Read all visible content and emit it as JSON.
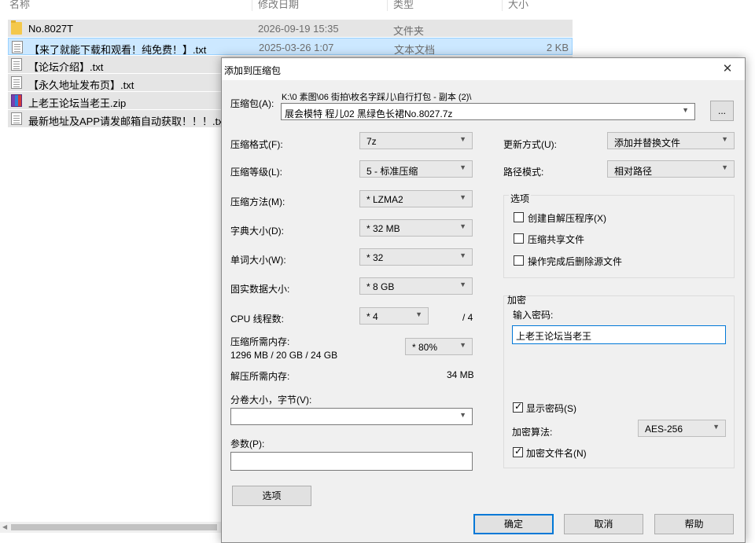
{
  "explorer": {
    "columns": {
      "name": "名称",
      "date": "修改日期",
      "type": "类型",
      "size": "大小"
    },
    "files": [
      {
        "name": "No.8027T",
        "date": "2026-09-19 15:35",
        "type": "文件夹",
        "size": "",
        "icon": "folder-icon"
      },
      {
        "name": "【来了就能下载和观看！纯免费！】.txt",
        "date": "2025-03-26 1:07",
        "type": "文本文档",
        "size": "2 KB",
        "icon": "text-file-icon"
      },
      {
        "name": "【论坛介绍】.txt",
        "date": "",
        "type": "",
        "size": "",
        "icon": "text-file-icon"
      },
      {
        "name": "【永久地址发布页】.txt",
        "date": "",
        "type": "",
        "size": "",
        "icon": "text-file-icon"
      },
      {
        "name": "上老王论坛当老王.zip",
        "date": "",
        "type": "",
        "size": "",
        "icon": "zip-file-icon"
      },
      {
        "name": "最新地址及APP请发邮箱自动获取！！！.txt",
        "date": "",
        "type": "",
        "size": "",
        "icon": "text-file-icon"
      }
    ]
  },
  "dialog": {
    "title": "添加到压缩包",
    "close": "✕",
    "archive": {
      "label": "压缩包(A):",
      "path": "K:\\0 素图\\06 街拍\\枚名字踩儿\\自行打包 - 副本 (2)\\",
      "filename": "展会模特 程儿02 黑绿色长裙No.8027.7z",
      "browse": "..."
    },
    "left": {
      "format": {
        "label": "压缩格式(F):",
        "value": "7z"
      },
      "level": {
        "label": "压缩等级(L):",
        "value": "5 - 标准压缩"
      },
      "method": {
        "label": "压缩方法(M):",
        "value": "* LZMA2"
      },
      "dict": {
        "label": "字典大小(D):",
        "value": "* 32 MB"
      },
      "word": {
        "label": "单词大小(W):",
        "value": "* 32"
      },
      "solid": {
        "label": "固实数据大小:",
        "value": "* 8 GB"
      },
      "cpu": {
        "label": "CPU 线程数:",
        "value": "* 4",
        "max": "/ 4"
      },
      "mem_compress": {
        "label": "压缩所需内存:",
        "detail": "1296 MB / 20 GB / 24 GB",
        "value": "* 80%"
      },
      "mem_decompress": {
        "label": "解压所需内存:",
        "value": "34 MB"
      },
      "split": {
        "label": "分卷大小，字节(V):",
        "value": ""
      },
      "params": {
        "label": "参数(P):",
        "value": ""
      },
      "options_button": "选项"
    },
    "right": {
      "update": {
        "label": "更新方式(U):",
        "value": "添加并替换文件"
      },
      "pathmode": {
        "label": "路径模式:",
        "value": "相对路径"
      },
      "options_group": {
        "title": "选项",
        "items": [
          {
            "label": "创建自解压程序(X)",
            "checked": false
          },
          {
            "label": "压缩共享文件",
            "checked": false
          },
          {
            "label": "操作完成后删除源文件",
            "checked": false
          }
        ]
      },
      "encryption": {
        "title": "加密",
        "password_label": "输入密码:",
        "password_value": "上老王论坛当老王",
        "show_password": {
          "label": "显示密码(S)",
          "checked": true
        },
        "method_label": "加密算法:",
        "method_value": "AES-256",
        "encrypt_names": {
          "label": "加密文件名(N)",
          "checked": true
        }
      }
    },
    "buttons": {
      "ok": "确定",
      "cancel": "取消",
      "help": "帮助"
    }
  },
  "colors": {
    "selection": "#cce8ff",
    "focus_border": "#0078d7",
    "dialog_bg": "#f0f0f0"
  }
}
